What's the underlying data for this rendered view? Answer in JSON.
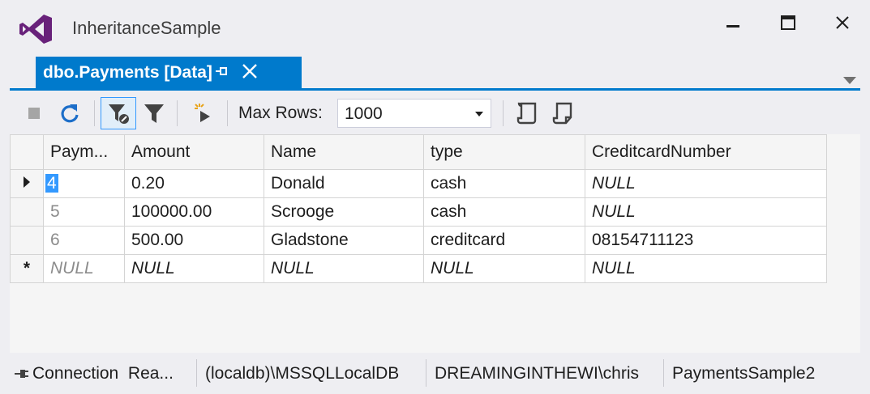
{
  "window": {
    "title": "InheritanceSample",
    "accent_color": "#007acc",
    "logo_color": "#68217a"
  },
  "tab": {
    "label": "dbo.Payments [Data]",
    "icons": [
      "pin-icon",
      "close-icon"
    ]
  },
  "toolbar": {
    "max_rows_label": "Max Rows:",
    "max_rows_value": "1000",
    "icons": [
      "stop-icon",
      "refresh-icon",
      "filter-clear-icon",
      "filter-icon",
      "add-row-icon",
      "script-icon",
      "script-file-icon"
    ]
  },
  "grid": {
    "columns": [
      "Paym...",
      "Amount",
      "Name",
      "type",
      "CreditcardNumber"
    ],
    "rows": [
      {
        "marker": "current",
        "cells": [
          "4",
          "0.20",
          "Donald",
          "cash",
          "NULL"
        ]
      },
      {
        "marker": "",
        "cells": [
          "5",
          "100000.00",
          "Scrooge",
          "cash",
          "NULL"
        ]
      },
      {
        "marker": "",
        "cells": [
          "6",
          "500.00",
          "Gladstone",
          "creditcard",
          "08154711123"
        ]
      },
      {
        "marker": "*",
        "cells": [
          "NULL",
          "NULL",
          "NULL",
          "NULL",
          "NULL"
        ]
      }
    ]
  },
  "status": {
    "connection": "Connection  Rea...",
    "server": "(localdb)\\MSSQLLocalDB",
    "user": "DREAMINGINTHEWI\\chris",
    "database": "PaymentsSample2"
  }
}
